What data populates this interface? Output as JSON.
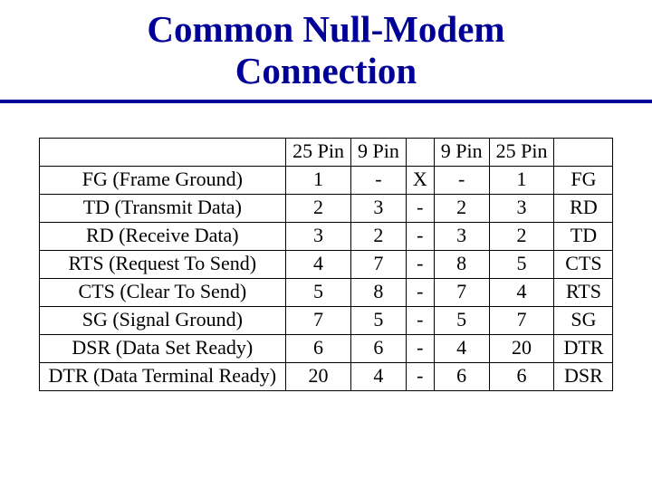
{
  "title_line1": "Common Null-Modem",
  "title_line2": "Connection",
  "headers": {
    "c1": "",
    "c2": "25 Pin",
    "c3": "9 Pin",
    "c4": "",
    "c5": "9 Pin",
    "c6": "25 Pin",
    "c7": ""
  },
  "rows": [
    {
      "left": "FG (Frame Ground)",
      "l25": "1",
      "l9": "-",
      "mid": "X",
      "r9": "-",
      "r25": "1",
      "right": "FG"
    },
    {
      "left": "TD (Transmit Data)",
      "l25": "2",
      "l9": "3",
      "mid": "-",
      "r9": "2",
      "r25": "3",
      "right": "RD"
    },
    {
      "left": "RD (Receive Data)",
      "l25": "3",
      "l9": "2",
      "mid": "-",
      "r9": "3",
      "r25": "2",
      "right": "TD"
    },
    {
      "left": "RTS (Request To Send)",
      "l25": "4",
      "l9": "7",
      "mid": "-",
      "r9": "8",
      "r25": "5",
      "right": "CTS"
    },
    {
      "left": "CTS (Clear To Send)",
      "l25": "5",
      "l9": "8",
      "mid": "-",
      "r9": "7",
      "r25": "4",
      "right": "RTS"
    },
    {
      "left": "SG (Signal Ground)",
      "l25": "7",
      "l9": "5",
      "mid": "-",
      "r9": "5",
      "r25": "7",
      "right": "SG"
    },
    {
      "left": "DSR (Data Set Ready)",
      "l25": "6",
      "l9": "6",
      "mid": "-",
      "r9": "4",
      "r25": "20",
      "right": "DTR"
    },
    {
      "left": "DTR (Data Terminal Ready)",
      "l25": "20",
      "l9": "4",
      "mid": "-",
      "r9": "6",
      "r25": "6",
      "right": "DSR"
    }
  ]
}
